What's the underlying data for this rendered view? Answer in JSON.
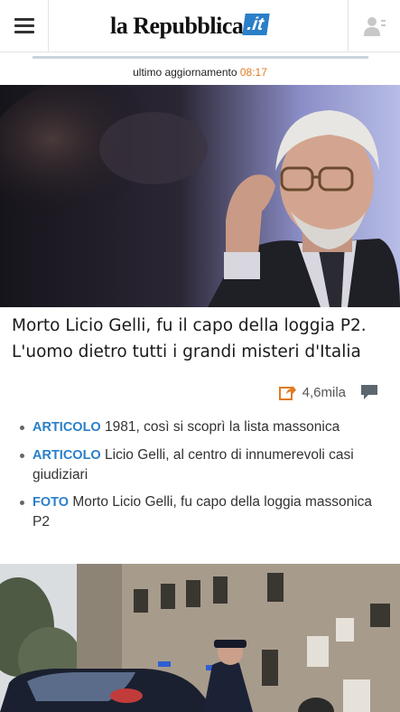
{
  "header": {
    "logo_main": "la Repubblica",
    "logo_tld": ".it"
  },
  "update": {
    "label": "ultimo aggiornamento",
    "time": "08:17"
  },
  "lead": {
    "headline": "Morto Licio Gelli, fu il capo della loggia P2. L'uomo dietro tutti i grandi misteri d'Italia",
    "shares": "4,6mila"
  },
  "related": [
    {
      "kind": "ARTICOLO",
      "text": "1981, così si scoprì la lista massonica"
    },
    {
      "kind": "ARTICOLO",
      "text": "Licio Gelli, al centro di innumerevoli casi giudiziari"
    },
    {
      "kind": "FOTO",
      "text": "Morto Licio Gelli, fu capo della loggia massonica P2"
    }
  ],
  "colors": {
    "accent": "#2a7fc8",
    "time": "#e07a1f"
  },
  "icons": {
    "menu": "hamburger-menu-icon",
    "user": "user-icon",
    "share": "share-icon",
    "comments": "comments-icon"
  }
}
